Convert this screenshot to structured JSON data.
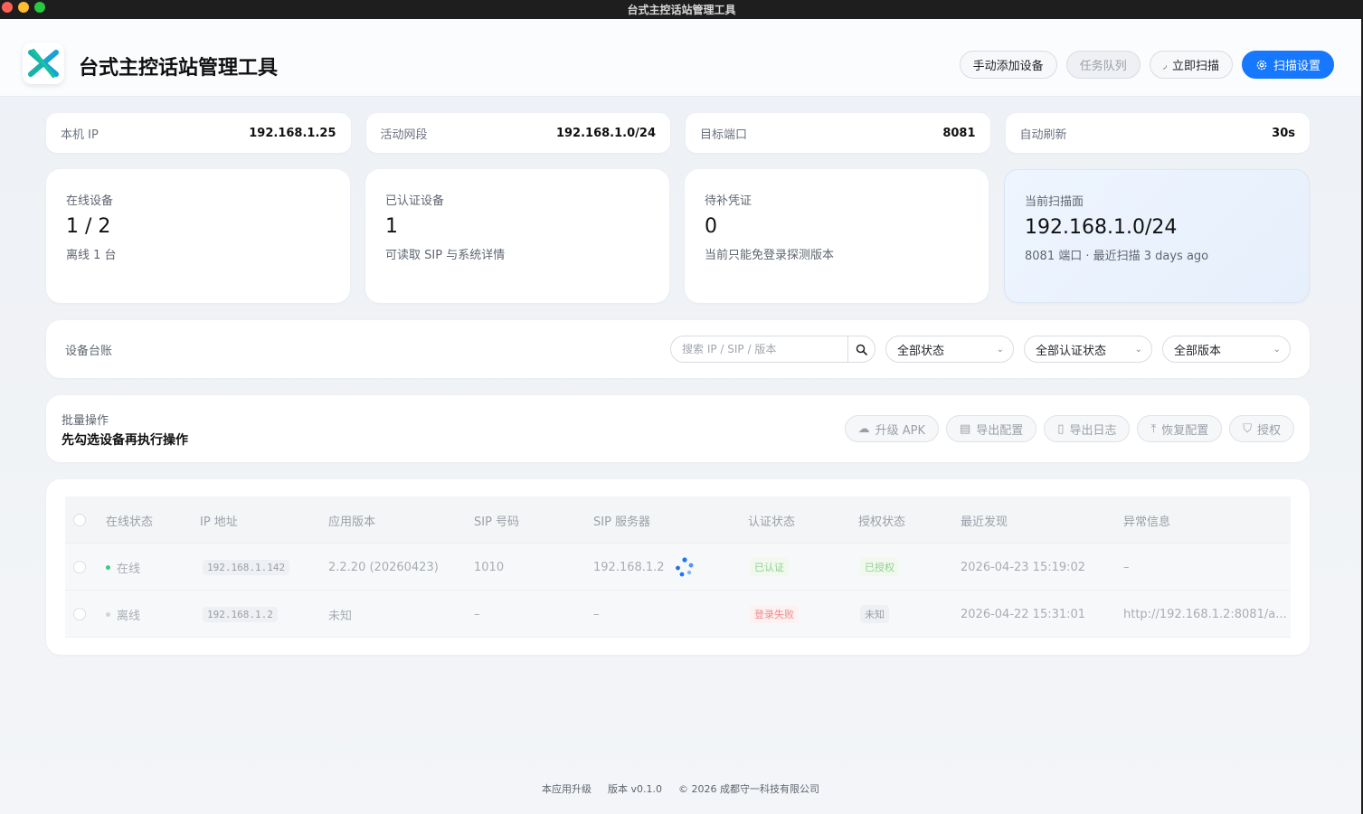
{
  "window": {
    "title": "台式主控话站管理工具"
  },
  "header": {
    "title": "台式主控话站管理工具",
    "actions": {
      "add_device": "手动添加设备",
      "task_queue": "任务队列",
      "scan_now": "立即扫描",
      "scan_settings": "扫描设置"
    }
  },
  "info": [
    {
      "label": "本机 IP",
      "value": "192.168.1.25"
    },
    {
      "label": "活动网段",
      "value": "192.168.1.0/24"
    },
    {
      "label": "目标端口",
      "value": "8081"
    },
    {
      "label": "自动刷新",
      "value": "30s"
    }
  ],
  "stats": [
    {
      "label": "在线设备",
      "value": "1 / 2",
      "sub": "离线 1 台"
    },
    {
      "label": "已认证设备",
      "value": "1",
      "sub": "可读取 SIP 与系统详情"
    },
    {
      "label": "待补凭证",
      "value": "0",
      "sub": "当前只能免登录探测版本"
    },
    {
      "label": "当前扫描面",
      "value": "192.168.1.0/24",
      "sub": "8081 端口 · 最近扫描 3 days ago"
    }
  ],
  "toolbar": {
    "title": "设备台账",
    "search_placeholder": "搜索 IP / SIP / 版本",
    "filter_status": "全部状态",
    "filter_auth": "全部认证状态",
    "filter_version": "全部版本"
  },
  "batch": {
    "label": "批量操作",
    "hint": "先勾选设备再执行操作",
    "upgrade_apk": "升级 APK",
    "export_config": "导出配置",
    "export_log": "导出日志",
    "restore_config": "恢复配置",
    "authorize": "授权"
  },
  "table": {
    "headers": {
      "online": "在线状态",
      "ip": "IP 地址",
      "version": "应用版本",
      "sip": "SIP 号码",
      "sip_server": "SIP 服务器",
      "auth": "认证状态",
      "license": "授权状态",
      "last_seen": "最近发现",
      "error": "异常信息"
    },
    "rows": [
      {
        "online": "在线",
        "ip": "192.168.1.142",
        "version": "2.2.20 (20260423)",
        "sip": "1010",
        "sip_server": "192.168.1.2",
        "auth": "已认证",
        "license": "已授权",
        "last_seen": "2026-04-23 15:19:02",
        "error": "–"
      },
      {
        "online": "离线",
        "ip": "192.168.1.2",
        "version": "未知",
        "sip": "–",
        "sip_server": "–",
        "auth": "登录失败",
        "license": "未知",
        "last_seen": "2026-04-22 15:31:01",
        "error": "http://192.168.1.2:8081/a..."
      }
    ]
  },
  "footer": {
    "upgrade": "本应用升级",
    "version": "版本 v0.1.0",
    "copyright": "© 2026 成都守一科技有限公司"
  },
  "colors": {
    "primary": "#1677ff",
    "online_dot": "#3cc98a",
    "offline_dot": "#d0d4da"
  }
}
